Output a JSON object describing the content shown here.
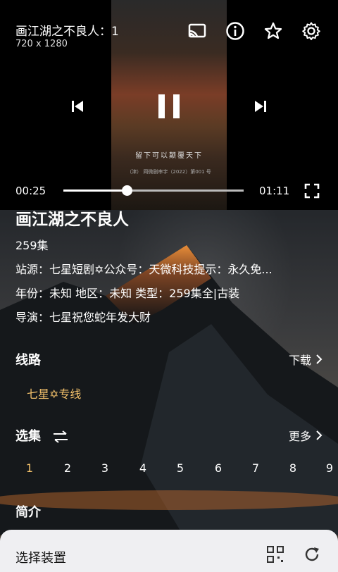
{
  "player": {
    "title": "画江湖之不良人：1",
    "resolution": "720 x 1280",
    "subtitle": "留下可以颠覆天下",
    "license_text": "（津） 网微剧审字（2022）第001 号",
    "current_time": "00:25",
    "total_time": "01:11",
    "progress_fraction": 0.35,
    "icons": [
      "cast-icon",
      "info-icon",
      "star-icon",
      "settings-icon",
      "previous-icon",
      "pause-icon",
      "next-icon",
      "fullscreen-icon"
    ]
  },
  "details": {
    "title": "画江湖之不良人",
    "episodes_count": "259集",
    "source": "站源：七星短剧✡公众号：天微科技提示：永久免...",
    "meta": "年份：未知  地区：未知  类型：259集全|古装",
    "director": "导演：七星祝您蛇年发大财"
  },
  "route": {
    "heading": "线路",
    "download_label": "下载",
    "item_label": "七星✡专线"
  },
  "episodes": {
    "heading": "选集",
    "more_label": "更多",
    "items": [
      "1",
      "2",
      "3",
      "4",
      "5",
      "6",
      "7",
      "8",
      "9"
    ],
    "active_color": "#f3c16b"
  },
  "intro": {
    "heading": "简介"
  },
  "device_sheet": {
    "title": "选择装置",
    "icons": [
      "qr-code-icon",
      "refresh-icon"
    ]
  }
}
